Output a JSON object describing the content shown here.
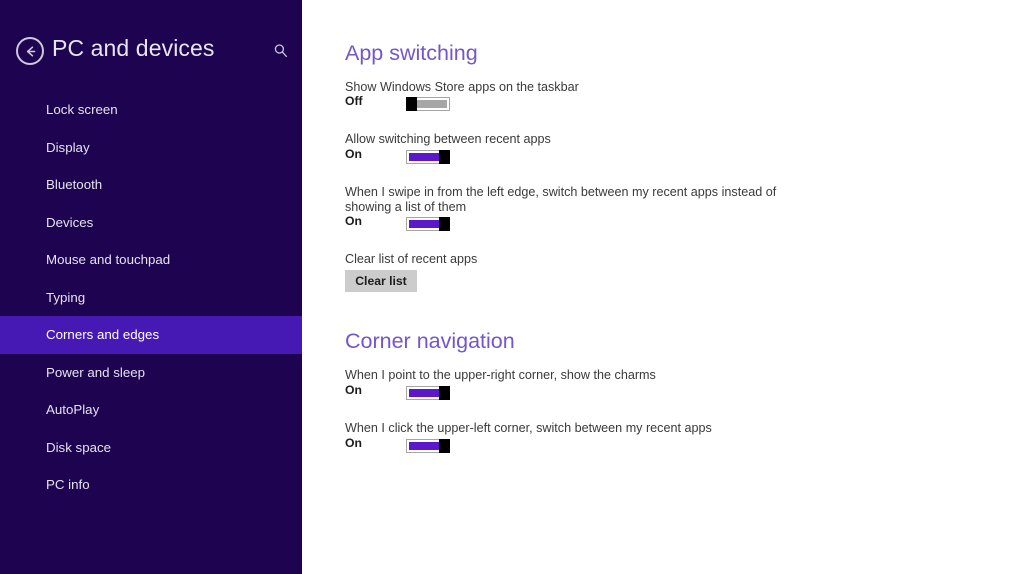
{
  "sidebar": {
    "back_icon": "back-arrow-icon",
    "title": "PC and devices",
    "search_icon": "search-icon",
    "items": [
      {
        "label": "Lock screen",
        "selected": false
      },
      {
        "label": "Display",
        "selected": false
      },
      {
        "label": "Bluetooth",
        "selected": false
      },
      {
        "label": "Devices",
        "selected": false
      },
      {
        "label": "Mouse and touchpad",
        "selected": false
      },
      {
        "label": "Typing",
        "selected": false
      },
      {
        "label": "Corners and edges",
        "selected": true
      },
      {
        "label": "Power and sleep",
        "selected": false
      },
      {
        "label": "AutoPlay",
        "selected": false
      },
      {
        "label": "Disk space",
        "selected": false
      },
      {
        "label": "PC info",
        "selected": false
      }
    ]
  },
  "main": {
    "sections": [
      {
        "heading": "App switching",
        "settings": [
          {
            "label": "Show Windows Store apps on the taskbar",
            "state": "Off",
            "toggle_on": false
          },
          {
            "label": "Allow switching between recent apps",
            "state": "On",
            "toggle_on": true
          },
          {
            "label": "When I swipe in from the left edge, switch between my recent apps instead of showing a list of them",
            "state": "On",
            "toggle_on": true
          },
          {
            "label": "Clear list of recent apps",
            "button_label": "Clear list"
          }
        ]
      },
      {
        "heading": "Corner navigation",
        "settings": [
          {
            "label": "When I point to the upper-right corner, show the charms",
            "state": "On",
            "toggle_on": true
          },
          {
            "label": "When I click the upper-left corner, switch between my recent apps",
            "state": "On",
            "toggle_on": true
          }
        ]
      }
    ]
  },
  "colors": {
    "sidebar_bg": "#1e0450",
    "sidebar_selected": "#4719b4",
    "heading_accent": "#7356cc",
    "toggle_on": "#5b17c9",
    "toggle_off_track": "#a6a6a6",
    "button_bg": "#cccccc"
  }
}
